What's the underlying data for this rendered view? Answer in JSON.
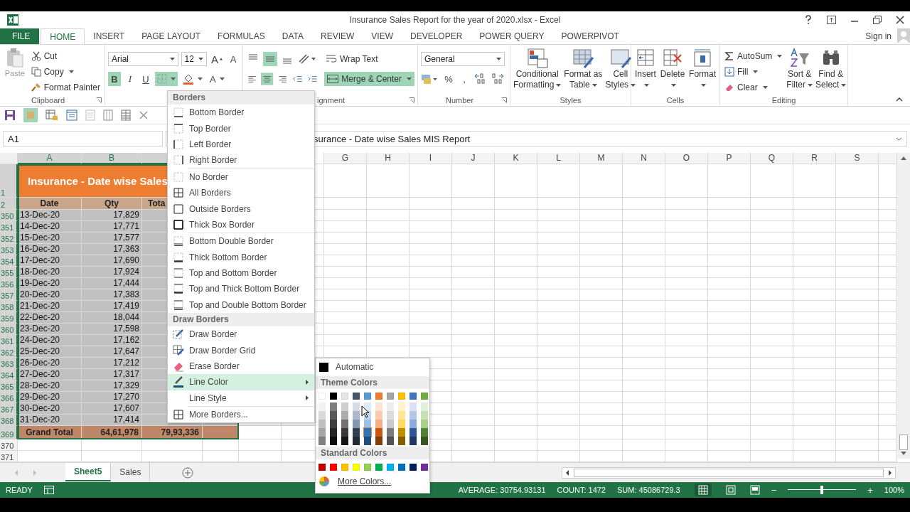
{
  "window": {
    "title": "Insurance Sales Report for the year of 2020.xlsx - Excel"
  },
  "menu_tabs": [
    {
      "label": "FILE",
      "kind": "file",
      "selected": false
    },
    {
      "label": "HOME",
      "kind": "tab",
      "selected": true
    },
    {
      "label": "INSERT",
      "kind": "tab",
      "selected": false
    },
    {
      "label": "PAGE LAYOUT",
      "kind": "tab",
      "selected": false
    },
    {
      "label": "FORMULAS",
      "kind": "tab",
      "selected": false
    },
    {
      "label": "DATA",
      "kind": "tab",
      "selected": false
    },
    {
      "label": "REVIEW",
      "kind": "tab",
      "selected": false
    },
    {
      "label": "VIEW",
      "kind": "tab",
      "selected": false
    },
    {
      "label": "DEVELOPER",
      "kind": "tab",
      "selected": false
    },
    {
      "label": "POWER QUERY",
      "kind": "tab",
      "selected": false
    },
    {
      "label": "POWERPIVOT",
      "kind": "tab",
      "selected": false
    }
  ],
  "account": {
    "label": "Sign in"
  },
  "ribbon": {
    "clipboard": {
      "paste": "Paste",
      "cut": "Cut",
      "copy": "Copy",
      "format_painter": "Format Painter",
      "label": "Clipboard"
    },
    "font": {
      "name": "Arial",
      "size": "12",
      "grow": "A",
      "shrink": "A",
      "bold": {
        "label": "B",
        "selected": true
      },
      "italic": {
        "label": "I",
        "selected": false
      },
      "underline": {
        "label": "U",
        "selected": false
      },
      "borders": {
        "selected": true
      },
      "font_color": "A"
    },
    "alignment": {
      "middle": {
        "selected": true
      },
      "center": {
        "selected": true
      },
      "wrap": "Wrap Text",
      "merge": {
        "label": "Merge & Center",
        "selected": true
      },
      "label": "ignment"
    },
    "number": {
      "format": "General",
      "percent": "%",
      "comma": ",",
      "label": "Number"
    },
    "styles": {
      "buttons": [
        {
          "lines": [
            "Conditional",
            "Formatting"
          ]
        },
        {
          "lines": [
            "Format as",
            "Table"
          ]
        },
        {
          "lines": [
            "Cell",
            "Styles"
          ]
        }
      ],
      "label": "Styles"
    },
    "cells": {
      "buttons": [
        "Insert",
        "Delete",
        "Format"
      ],
      "label": "Cells"
    },
    "editing": {
      "autosum": "AutoSum",
      "fill": "Fill",
      "clear": "Clear",
      "sort": [
        "Sort &",
        "Filter"
      ],
      "find": [
        "Find &",
        "Select"
      ],
      "label": "Editing"
    }
  },
  "formula_bar": {
    "name_box": "A1",
    "formula": "surance - Date wise Sales MIS Report"
  },
  "sheet": {
    "columns_left": [
      "A",
      "B"
    ],
    "columns_right": [
      "G",
      "H",
      "I",
      "J",
      "K",
      "L",
      "M",
      "N",
      "O",
      "P",
      "Q",
      "R",
      "S"
    ],
    "title": {
      "row": "1",
      "text": "Insurance - Date wise Sales"
    },
    "header": {
      "row": "2",
      "cells": [
        "Date",
        "Qty",
        "Tota"
      ]
    },
    "rows": [
      {
        "row": "350",
        "date": "13-Dec-20",
        "qty": "17,829"
      },
      {
        "row": "351",
        "date": "14-Dec-20",
        "qty": "17,771"
      },
      {
        "row": "352",
        "date": "15-Dec-20",
        "qty": "17,577"
      },
      {
        "row": "353",
        "date": "16-Dec-20",
        "qty": "17,363"
      },
      {
        "row": "354",
        "date": "17-Dec-20",
        "qty": "17,690"
      },
      {
        "row": "355",
        "date": "18-Dec-20",
        "qty": "17,924"
      },
      {
        "row": "356",
        "date": "19-Dec-20",
        "qty": "17,444"
      },
      {
        "row": "357",
        "date": "20-Dec-20",
        "qty": "17,383"
      },
      {
        "row": "358",
        "date": "21-Dec-20",
        "qty": "17,419"
      },
      {
        "row": "359",
        "date": "22-Dec-20",
        "qty": "18,044"
      },
      {
        "row": "360",
        "date": "23-Dec-20",
        "qty": "17,598"
      },
      {
        "row": "361",
        "date": "24-Dec-20",
        "qty": "17,162"
      },
      {
        "row": "362",
        "date": "25-Dec-20",
        "qty": "17,647"
      },
      {
        "row": "363",
        "date": "26-Dec-20",
        "qty": "17,212"
      },
      {
        "row": "364",
        "date": "27-Dec-20",
        "qty": "17,317"
      },
      {
        "row": "365",
        "date": "28-Dec-20",
        "qty": "17,329"
      },
      {
        "row": "366",
        "date": "29-Dec-20",
        "qty": "17,270"
      },
      {
        "row": "367",
        "date": "30-Dec-20",
        "qty": "17,607"
      },
      {
        "row": "368",
        "date": "31-Dec-20",
        "qty": "17,414"
      }
    ],
    "total": {
      "row": "369",
      "label": "Grand Total",
      "qty": "64,61,978",
      "amount": "79,93,336"
    },
    "empty_rows": [
      "370",
      "371"
    ]
  },
  "sheet_tabs": [
    {
      "label": "Sheet5",
      "selected": true
    },
    {
      "label": "Sales",
      "selected": false
    }
  ],
  "status_bar": {
    "mode": "READY",
    "average": "AVERAGE: 30754.93131",
    "count": "COUNT: 1472",
    "sum": "SUM: 45086729.3",
    "zoom": "100%",
    "zoom_out": "−",
    "zoom_in": "+",
    "zoom_level": {
      "level": 0.5
    }
  },
  "borders_menu": {
    "sections": [
      {
        "title": "Borders",
        "groups": [
          [
            {
              "label": "Bottom Border",
              "kind": "bottom",
              "selected": false,
              "submenu": false
            },
            {
              "label": "Top Border",
              "kind": "top",
              "selected": false,
              "submenu": false
            },
            {
              "label": "Left Border",
              "kind": "left",
              "selected": false,
              "submenu": false
            },
            {
              "label": "Right Border",
              "kind": "right",
              "selected": false,
              "submenu": false
            }
          ],
          [
            {
              "label": "No Border",
              "kind": "none",
              "selected": false,
              "submenu": false
            },
            {
              "label": "All Borders",
              "kind": "all",
              "selected": false,
              "submenu": false
            },
            {
              "label": "Outside Borders",
              "kind": "outside",
              "selected": false,
              "submenu": false
            },
            {
              "label": "Thick Box Border",
              "kind": "thick-box",
              "selected": false,
              "submenu": false
            }
          ],
          [
            {
              "label": "Bottom Double Border",
              "kind": "bottom-double",
              "selected": false,
              "submenu": false
            },
            {
              "label": "Thick Bottom Border",
              "kind": "thick-bottom",
              "selected": false,
              "submenu": false
            },
            {
              "label": "Top and Bottom Border",
              "kind": "top-bottom",
              "selected": false,
              "submenu": false
            },
            {
              "label": "Top and Thick Bottom Border",
              "kind": "top-thick-bottom",
              "selected": false,
              "submenu": false
            },
            {
              "label": "Top and Double Bottom Border",
              "kind": "top-double-bottom",
              "selected": false,
              "submenu": false
            }
          ]
        ]
      },
      {
        "title": "Draw Borders",
        "groups": [
          [
            {
              "label": "Draw Border",
              "kind": "draw",
              "selected": false,
              "submenu": false
            },
            {
              "label": "Draw Border Grid",
              "kind": "draw-grid",
              "selected": false,
              "submenu": false
            },
            {
              "label": "Erase Border",
              "kind": "erase",
              "selected": false,
              "submenu": false
            },
            {
              "label": "Line Color",
              "kind": "line-color",
              "selected": true,
              "submenu": true
            },
            {
              "label": "Line Style",
              "kind": "line-style",
              "selected": false,
              "submenu": true
            }
          ],
          [
            {
              "label": "More Borders...",
              "kind": "all",
              "selected": false,
              "submenu": false
            }
          ]
        ]
      }
    ]
  },
  "color_palette": {
    "automatic": {
      "label": "Automatic",
      "color": "#000000"
    },
    "theme_title": "Theme Colors",
    "theme": [
      {
        "color": "#ffffff",
        "shades": [
          {
            "color": "#f2f2f2",
            "selected": false
          },
          {
            "color": "#d9d9d9",
            "selected": false
          },
          {
            "color": "#bfbfbf",
            "selected": false
          },
          {
            "color": "#a6a6a6",
            "selected": false
          },
          {
            "color": "#808080",
            "selected": false
          }
        ]
      },
      {
        "color": "#000000",
        "shades": [
          {
            "color": "#7f7f7f",
            "selected": false
          },
          {
            "color": "#595959",
            "selected": false
          },
          {
            "color": "#404040",
            "selected": false
          },
          {
            "color": "#262626",
            "selected": false
          },
          {
            "color": "#0d0d0d",
            "selected": false
          }
        ]
      },
      {
        "color": "#e7e6e6",
        "shades": [
          {
            "color": "#d0cece",
            "selected": false
          },
          {
            "color": "#aeabab",
            "selected": false
          },
          {
            "color": "#757171",
            "selected": false
          },
          {
            "color": "#3a3838",
            "selected": false
          },
          {
            "color": "#171616",
            "selected": false
          }
        ]
      },
      {
        "color": "#44546a",
        "shades": [
          {
            "color": "#d6dce4",
            "selected": false
          },
          {
            "color": "#adb9ca",
            "selected": false
          },
          {
            "color": "#8496b0",
            "selected": false
          },
          {
            "color": "#333f4f",
            "selected": false
          },
          {
            "color": "#222a35",
            "selected": false
          }
        ]
      },
      {
        "color": "#5b9bd5",
        "shades": [
          {
            "color": "#ddebf7",
            "selected": false
          },
          {
            "color": "#bdd7ee",
            "selected": false
          },
          {
            "color": "#9bc2e6",
            "selected": false
          },
          {
            "color": "#2f75b5",
            "selected": true
          },
          {
            "color": "#1f4e78",
            "selected": false
          }
        ]
      },
      {
        "color": "#ed7d31",
        "shades": [
          {
            "color": "#fce4d6",
            "selected": false
          },
          {
            "color": "#f8cbad",
            "selected": false
          },
          {
            "color": "#f4b084",
            "selected": false
          },
          {
            "color": "#c65911",
            "selected": false
          },
          {
            "color": "#833c0c",
            "selected": false
          }
        ]
      },
      {
        "color": "#a5a5a5",
        "shades": [
          {
            "color": "#ededed",
            "selected": false
          },
          {
            "color": "#dbdbdb",
            "selected": false
          },
          {
            "color": "#c9c9c9",
            "selected": false
          },
          {
            "color": "#7b7b7b",
            "selected": false
          },
          {
            "color": "#525252",
            "selected": false
          }
        ]
      },
      {
        "color": "#ffc000",
        "shades": [
          {
            "color": "#fff2cc",
            "selected": false
          },
          {
            "color": "#ffe699",
            "selected": false
          },
          {
            "color": "#ffd966",
            "selected": false
          },
          {
            "color": "#bf8f00",
            "selected": false
          },
          {
            "color": "#806000",
            "selected": false
          }
        ]
      },
      {
        "color": "#4472c4",
        "shades": [
          {
            "color": "#d9e1f2",
            "selected": false
          },
          {
            "color": "#b4c6e7",
            "selected": false
          },
          {
            "color": "#8ea9db",
            "selected": false
          },
          {
            "color": "#305496",
            "selected": false
          },
          {
            "color": "#203764",
            "selected": false
          }
        ]
      },
      {
        "color": "#70ad47",
        "shades": [
          {
            "color": "#e2efda",
            "selected": false
          },
          {
            "color": "#c6e0b4",
            "selected": false
          },
          {
            "color": "#a9d08e",
            "selected": false
          },
          {
            "color": "#548235",
            "selected": false
          },
          {
            "color": "#375623",
            "selected": false
          }
        ]
      }
    ],
    "standard_title": "Standard Colors",
    "standard": [
      {
        "color": "#c00000"
      },
      {
        "color": "#ff0000"
      },
      {
        "color": "#ffc000"
      },
      {
        "color": "#ffff00"
      },
      {
        "color": "#92d050"
      },
      {
        "color": "#00b050"
      },
      {
        "color": "#00b0f0"
      },
      {
        "color": "#0070c0"
      },
      {
        "color": "#002060"
      },
      {
        "color": "#7030a0"
      }
    ],
    "more": "More Colors..."
  }
}
